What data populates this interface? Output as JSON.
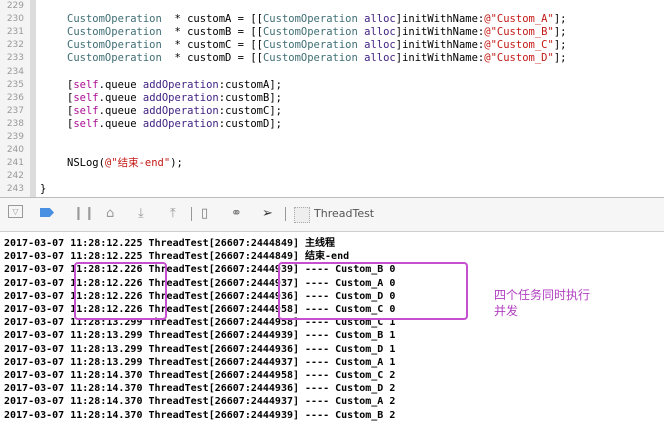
{
  "editor": {
    "lines": [
      {
        "n": "229",
        "parts": []
      },
      {
        "n": "230",
        "parts": [
          [
            "t",
            "CustomOperation"
          ],
          [
            "",
            "  * customA = [["
          ],
          [
            "t",
            "CustomOperation"
          ],
          [
            "",
            " "
          ],
          [
            "m",
            "alloc"
          ],
          [
            "",
            "]initWithName:"
          ],
          [
            "r",
            "@\"Custom_A\""
          ],
          [
            "",
            "];"
          ]
        ]
      },
      {
        "n": "231",
        "parts": [
          [
            "t",
            "CustomOperation"
          ],
          [
            "",
            "  * customB = [["
          ],
          [
            "t",
            "CustomOperation"
          ],
          [
            "",
            " "
          ],
          [
            "m",
            "alloc"
          ],
          [
            "",
            "]initWithName:"
          ],
          [
            "r",
            "@\"Custom_B\""
          ],
          [
            "",
            "];"
          ]
        ]
      },
      {
        "n": "232",
        "parts": [
          [
            "t",
            "CustomOperation"
          ],
          [
            "",
            "  * customC = [["
          ],
          [
            "t",
            "CustomOperation"
          ],
          [
            "",
            " "
          ],
          [
            "m",
            "alloc"
          ],
          [
            "",
            "]initWithName:"
          ],
          [
            "r",
            "@\"Custom_C\""
          ],
          [
            "",
            "];"
          ]
        ]
      },
      {
        "n": "233",
        "parts": [
          [
            "t",
            "CustomOperation"
          ],
          [
            "",
            "  * customD = [["
          ],
          [
            "t",
            "CustomOperation"
          ],
          [
            "",
            " "
          ],
          [
            "m",
            "alloc"
          ],
          [
            "",
            "]initWithName:"
          ],
          [
            "r",
            "@\"Custom_D\""
          ],
          [
            "",
            "];"
          ]
        ]
      },
      {
        "n": "234",
        "parts": []
      },
      {
        "n": "235",
        "parts": [
          [
            "",
            "["
          ],
          [
            "s",
            "self"
          ],
          [
            "",
            ".queue "
          ],
          [
            "m",
            "addOperation"
          ],
          [
            "",
            ":customA];"
          ]
        ]
      },
      {
        "n": "236",
        "parts": [
          [
            "",
            "["
          ],
          [
            "s",
            "self"
          ],
          [
            "",
            ".queue "
          ],
          [
            "m",
            "addOperation"
          ],
          [
            "",
            ":customB];"
          ]
        ]
      },
      {
        "n": "237",
        "parts": [
          [
            "",
            "["
          ],
          [
            "s",
            "self"
          ],
          [
            "",
            ".queue "
          ],
          [
            "m",
            "addOperation"
          ],
          [
            "",
            ":customC];"
          ]
        ]
      },
      {
        "n": "238",
        "parts": [
          [
            "",
            "["
          ],
          [
            "s",
            "self"
          ],
          [
            "",
            ".queue "
          ],
          [
            "m",
            "addOperation"
          ],
          [
            "",
            ":customD];"
          ]
        ]
      },
      {
        "n": "239",
        "parts": []
      },
      {
        "n": "240",
        "parts": []
      },
      {
        "n": "241",
        "parts": [
          [
            "",
            "NSLog("
          ],
          [
            "r",
            "@\"结束-end\""
          ],
          [
            "",
            ");"
          ]
        ]
      },
      {
        "n": "242",
        "parts": []
      },
      {
        "n": "243",
        "parts": [
          [
            "",
            "}"
          ]
        ]
      }
    ]
  },
  "toolbar": {
    "target": "ThreadTest"
  },
  "console": {
    "lines": [
      "2017-03-07 11:28:12.225 ThreadTest[26607:2444849] 主线程",
      "2017-03-07 11:28:12.225 ThreadTest[26607:2444849] 结束-end",
      "2017-03-07 11:28:12.226 ThreadTest[26607:2444939] ---- Custom_B 0",
      "2017-03-07 11:28:12.226 ThreadTest[26607:2444937] ---- Custom_A 0",
      "2017-03-07 11:28:12.226 ThreadTest[26607:2444936] ---- Custom_D 0",
      "2017-03-07 11:28:12.226 ThreadTest[26607:2444958] ---- Custom_C 0",
      "2017-03-07 11:28:13.299 ThreadTest[26607:2444958] ---- Custom_C 1",
      "2017-03-07 11:28:13.299 ThreadTest[26607:2444939] ---- Custom_B 1",
      "2017-03-07 11:28:13.299 ThreadTest[26607:2444936] ---- Custom_D 1",
      "2017-03-07 11:28:13.299 ThreadTest[26607:2444937] ---- Custom_A 1",
      "2017-03-07 11:28:14.370 ThreadTest[26607:2444958] ---- Custom_C 2",
      "2017-03-07 11:28:14.370 ThreadTest[26607:2444936] ---- Custom_D 2",
      "2017-03-07 11:28:14.370 ThreadTest[26607:2444937] ---- Custom_A 2",
      "2017-03-07 11:28:14.370 ThreadTest[26607:2444939] ---- Custom_B 2"
    ]
  },
  "annotation": {
    "line1": "四个任务同时执行",
    "line2": "并发",
    "color": "#c64fd0"
  }
}
